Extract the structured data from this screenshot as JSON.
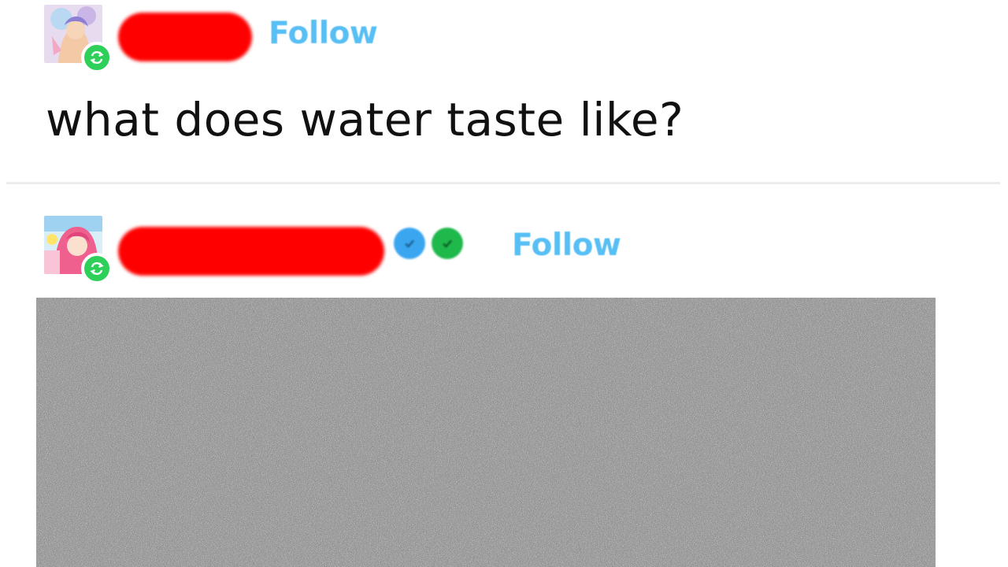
{
  "posts": [
    {
      "author": {
        "avatar_icon": "anime-avatar-icon",
        "name_redacted": true,
        "badges": []
      },
      "follow_label": "Follow",
      "body_text": "what does water taste like?"
    },
    {
      "author": {
        "avatar_icon": "pink-hair-avatar-icon",
        "name_redacted": true,
        "badges": [
          "blue-checkmark-icon",
          "green-checkmark-icon"
        ]
      },
      "follow_label": "Follow",
      "image": {
        "content": "static-noise"
      }
    }
  ],
  "colors": {
    "follow": "#58bff4",
    "redaction": "#ff0000",
    "reblog_badge": "#2fd05a",
    "badge_blue": "#3aa6f0",
    "badge_green": "#1fb84b"
  }
}
